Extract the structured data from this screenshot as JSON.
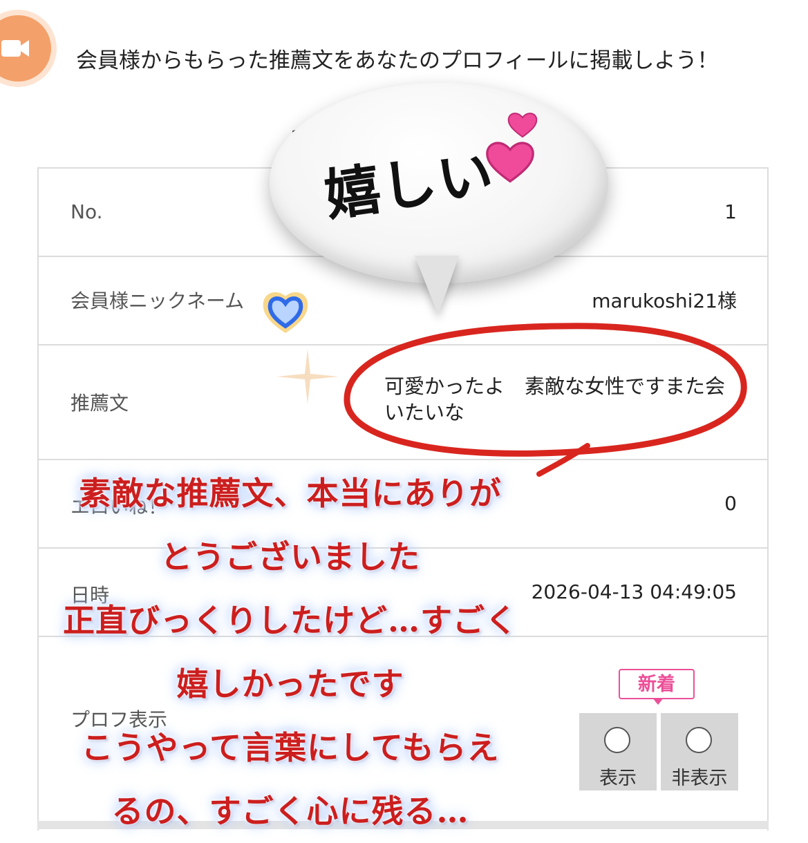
{
  "header": {
    "icon": "video-camera-icon",
    "headline": "会員様からもらった推薦文をあなたのプロフィールに掲載しよう！",
    "count_text": "1("
  },
  "table": {
    "rows": [
      {
        "label": "No.",
        "value": "1"
      },
      {
        "label": "会員様ニックネーム",
        "value": "marukoshi21様"
      },
      {
        "label": "推薦文",
        "value": "可愛かったよ　素敵な女性ですまた会いたいな"
      },
      {
        "label": "エロいね！",
        "value": "0"
      },
      {
        "label": "日時",
        "value": "2026-04-13 04:49:05"
      },
      {
        "label": "プロフ表示",
        "value": ""
      }
    ]
  },
  "toggle": {
    "badge": "新着",
    "show_label": "表示",
    "hide_label": "非表示"
  },
  "bubble": {
    "text": "嬉しい"
  },
  "overlay": {
    "lines": [
      "素敵な推薦文、本当にありが",
      "とうございました",
      "正直びっくりしたけど…すごく",
      "嬉しかったです",
      "こうやって言葉にしてもらえ",
      "るの、すごく心に残る…"
    ]
  },
  "colors": {
    "accent_orange": "#f4a06a",
    "badge_pink": "#ec4f98",
    "annotation_red": "#d8261f",
    "overlay_red": "#cc1e1e"
  }
}
